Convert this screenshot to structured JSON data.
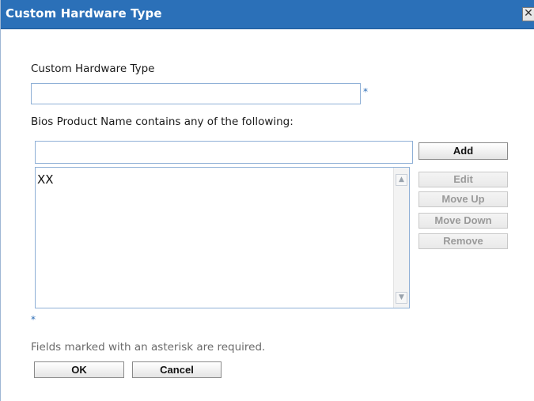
{
  "window": {
    "title": "Custom Hardware Type",
    "close_glyph": "✕"
  },
  "form": {
    "type_label": "Custom Hardware Type",
    "type_value": "",
    "required_marker": "*",
    "bios_label": "Bios Product Name contains any of the following:",
    "bios_entry_value": "",
    "list_items": [
      "XX"
    ],
    "list_required_marker": "*",
    "required_note": "Fields marked with an asterisk are required."
  },
  "side_buttons": {
    "add": "Add",
    "edit": "Edit",
    "move_up": "Move Up",
    "move_down": "Move Down",
    "remove": "Remove"
  },
  "footer_buttons": {
    "ok": "OK",
    "cancel": "Cancel"
  },
  "icons": {
    "scroll_up": "chevron-up-icon",
    "scroll_down": "chevron-down-icon",
    "close": "close-icon"
  },
  "colors": {
    "titlebar": "#2b70b8",
    "input_border": "#8fb0d6",
    "asterisk": "#2b6cb5"
  }
}
